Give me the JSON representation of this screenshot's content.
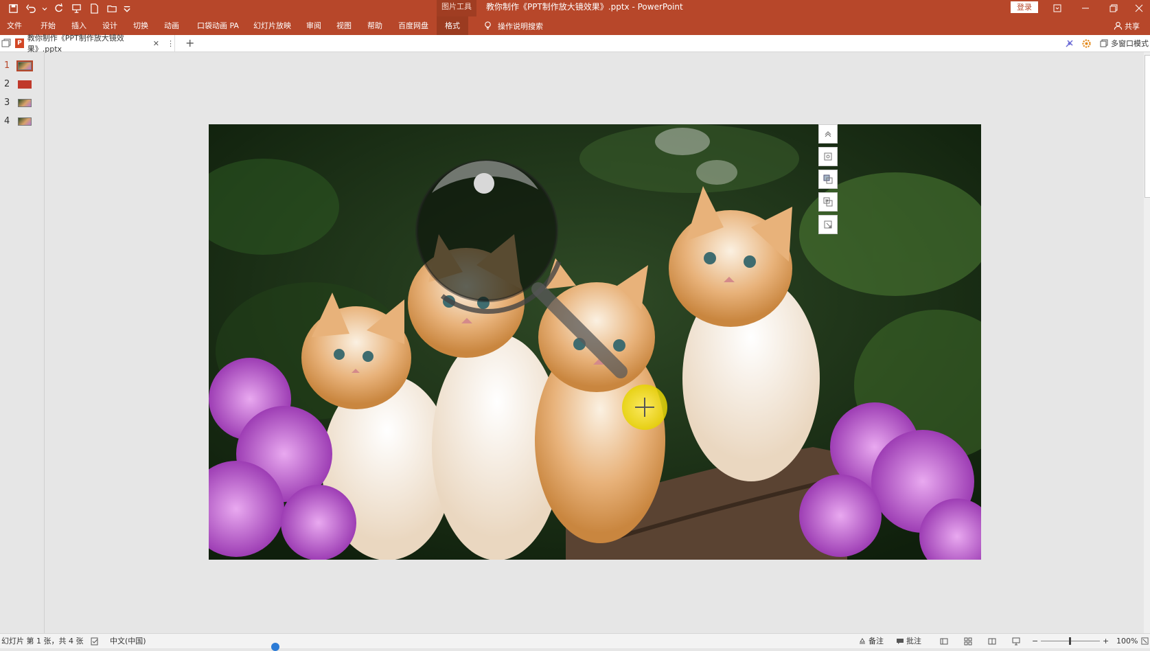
{
  "titlebar": {
    "context_group": "图片工具",
    "document_title": "教你制作《PPT制作放大镜效果》.pptx  -  PowerPoint",
    "login_label": "登录"
  },
  "ribbon": {
    "tabs": [
      "文件",
      "开始",
      "插入",
      "设计",
      "切换",
      "动画",
      "口袋动画 PA",
      "幻灯片放映",
      "审阅",
      "视图",
      "帮助",
      "百度网盘",
      "格式"
    ],
    "active_tab": "格式",
    "tell_me": "操作说明搜索",
    "share_label": "共享"
  },
  "docstrip": {
    "tab_title": "教你制作《PPT制作放大镜效果》.pptx",
    "plus": "+",
    "multiwindow_label": "多窗口模式"
  },
  "thumbnails": [
    {
      "number": "1",
      "selected": true
    },
    {
      "number": "2",
      "selected": false
    },
    {
      "number": "3",
      "selected": false
    },
    {
      "number": "4",
      "selected": false
    }
  ],
  "slide_tools": [
    "chevron-up-icon",
    "crop-icon",
    "bring-forward-icon",
    "send-backward-icon",
    "resize-icon"
  ],
  "statusbar": {
    "slide_info": "幻灯片 第 1 张，共 4 张",
    "language": "中文(中国)",
    "notes_label": "备注",
    "comments_label": "批注",
    "zoom_minus": "−",
    "zoom_plus": "+",
    "zoom_level": "100%"
  },
  "colors": {
    "accent": "#b7472a",
    "slide_bg": "#e6e6e6"
  }
}
